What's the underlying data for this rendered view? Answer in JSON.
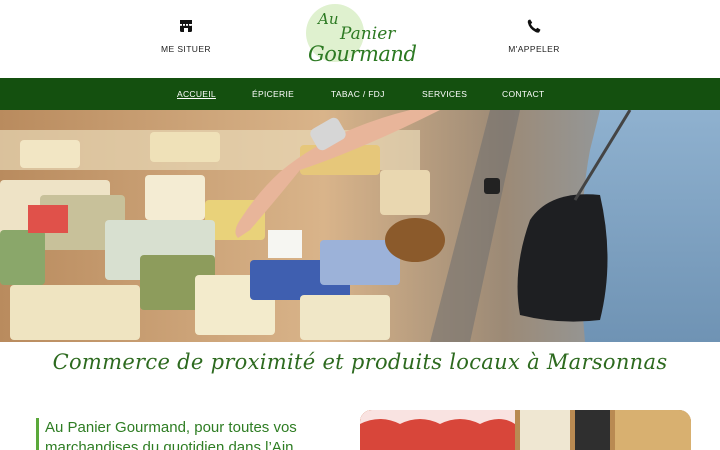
{
  "header": {
    "locate_label": "ME SITUER",
    "call_label": "M'APPELER",
    "logo": {
      "line1": "Au",
      "line2": "Panier",
      "line3": "Gourmand"
    }
  },
  "nav": {
    "items": [
      "ACCUEIL",
      "ÉPICERIE",
      "TABAC / FDJ",
      "SERVICES",
      "CONTACT"
    ],
    "active_index": 0
  },
  "tagline": "Commerce de proximité et produits locaux à Marsonnas",
  "intro": {
    "heading_line1": "Au Panier Gourmand, pour toutes vos",
    "heading_line2": "marchandises du quotidien dans l’Ain"
  },
  "colors": {
    "brand_green": "#14500f",
    "accent_green": "#5aa83a",
    "text_green": "#2d6a1f"
  }
}
